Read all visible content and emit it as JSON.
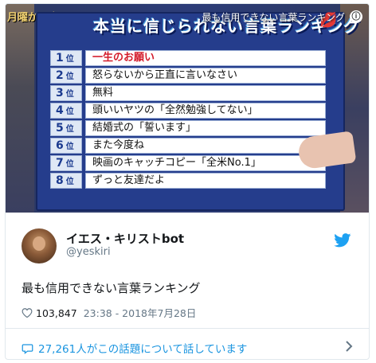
{
  "media": {
    "banner_left": "月曜から夜ふかし",
    "ticker": "最も信用できない言葉ランキング",
    "info_icon": "ⓘ",
    "board_title": "本当に信じられない言葉ランキング",
    "rank_suffix": "位",
    "rankings": [
      {
        "rank": "1",
        "text": "一生のお願い"
      },
      {
        "rank": "2",
        "text": "怒らないから正直に言いなさい"
      },
      {
        "rank": "3",
        "text": "無料"
      },
      {
        "rank": "4",
        "text": "頭いいヤツの「全然勉強してない」"
      },
      {
        "rank": "5",
        "text": "結婚式の「誓います」"
      },
      {
        "rank": "6",
        "text": "また今度ね"
      },
      {
        "rank": "7",
        "text": "映画のキャッチコピー「全米No.1」"
      },
      {
        "rank": "8",
        "text": "ずっと友達だよ"
      }
    ],
    "colors": {
      "board": "#253d8c",
      "first_place": "#d41c2b"
    }
  },
  "tweet": {
    "author_name": "イエス・キリストbot",
    "author_handle": "@yeskiri",
    "text": "最も信用できない言葉ランキング",
    "likes": "103,847",
    "timestamp": "23:38 - 2018年7月28日",
    "talk_text": "27,261人がこの話題について話しています",
    "icons": [
      "twitter-bird-icon",
      "heart-icon",
      "comment-icon",
      "chevron-right-icon"
    ],
    "link_color": "#1b95e0"
  }
}
